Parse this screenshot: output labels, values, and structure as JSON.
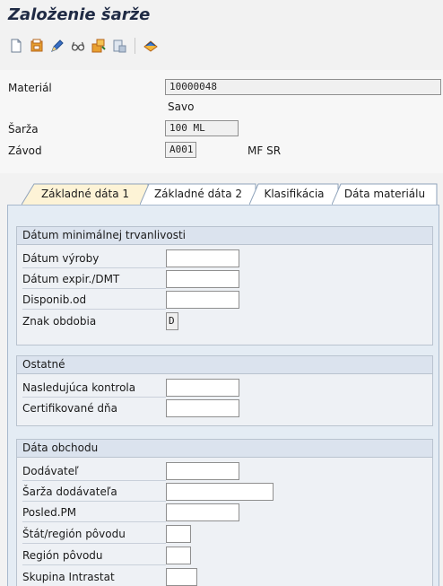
{
  "title": "Založenie šarže",
  "toolbar": {
    "icons": [
      "new-document-icon",
      "copy-icon",
      "edit-pencil-icon",
      "glasses-display-icon",
      "classification-icon",
      "stock-icon",
      "change-documents-icon"
    ]
  },
  "header": {
    "material_label": "Materiál",
    "material_value": "10000048",
    "material_desc": "Savo",
    "batch_label": "Šarža",
    "batch_value": "100 ML",
    "plant_label": "Závod",
    "plant_value": "A001",
    "plant_desc": "MF SR"
  },
  "tabs": [
    {
      "label": "Základné dáta 1",
      "active": true
    },
    {
      "label": "Základné dáta 2",
      "active": false
    },
    {
      "label": "Klasifikácia",
      "active": false
    },
    {
      "label": "Dáta materiálu",
      "active": false
    }
  ],
  "groups": {
    "shelf_life": {
      "title": "Dátum minimálnej trvanlivosti",
      "fields": [
        {
          "label": "Dátum výroby",
          "value": ""
        },
        {
          "label": "Dátum expir./DMT",
          "value": ""
        },
        {
          "label": "Disponib.od",
          "value": ""
        },
        {
          "label": "Znak obdobia",
          "value": "D"
        }
      ]
    },
    "other": {
      "title": "Ostatné",
      "fields": [
        {
          "label": "Nasledujúca kontrola",
          "value": ""
        },
        {
          "label": "Certifikované dňa",
          "value": ""
        }
      ]
    },
    "trade": {
      "title": "Dáta obchodu",
      "fields": [
        {
          "label": "Dodávateľ",
          "value": ""
        },
        {
          "label": "Šarža dodávateľa",
          "value": ""
        },
        {
          "label": "Posled.PM",
          "value": ""
        },
        {
          "label": "Štát/región pôvodu",
          "value": ""
        },
        {
          "label": "Región pôvodu",
          "value": ""
        },
        {
          "label": "Skupina Intrastat",
          "value": ""
        }
      ]
    }
  },
  "colors": {
    "title": "#1f2a44",
    "panel_bg": "#e4ecf4",
    "group_header": "#dbe3ee",
    "tab_active": "#fdf3d6"
  }
}
